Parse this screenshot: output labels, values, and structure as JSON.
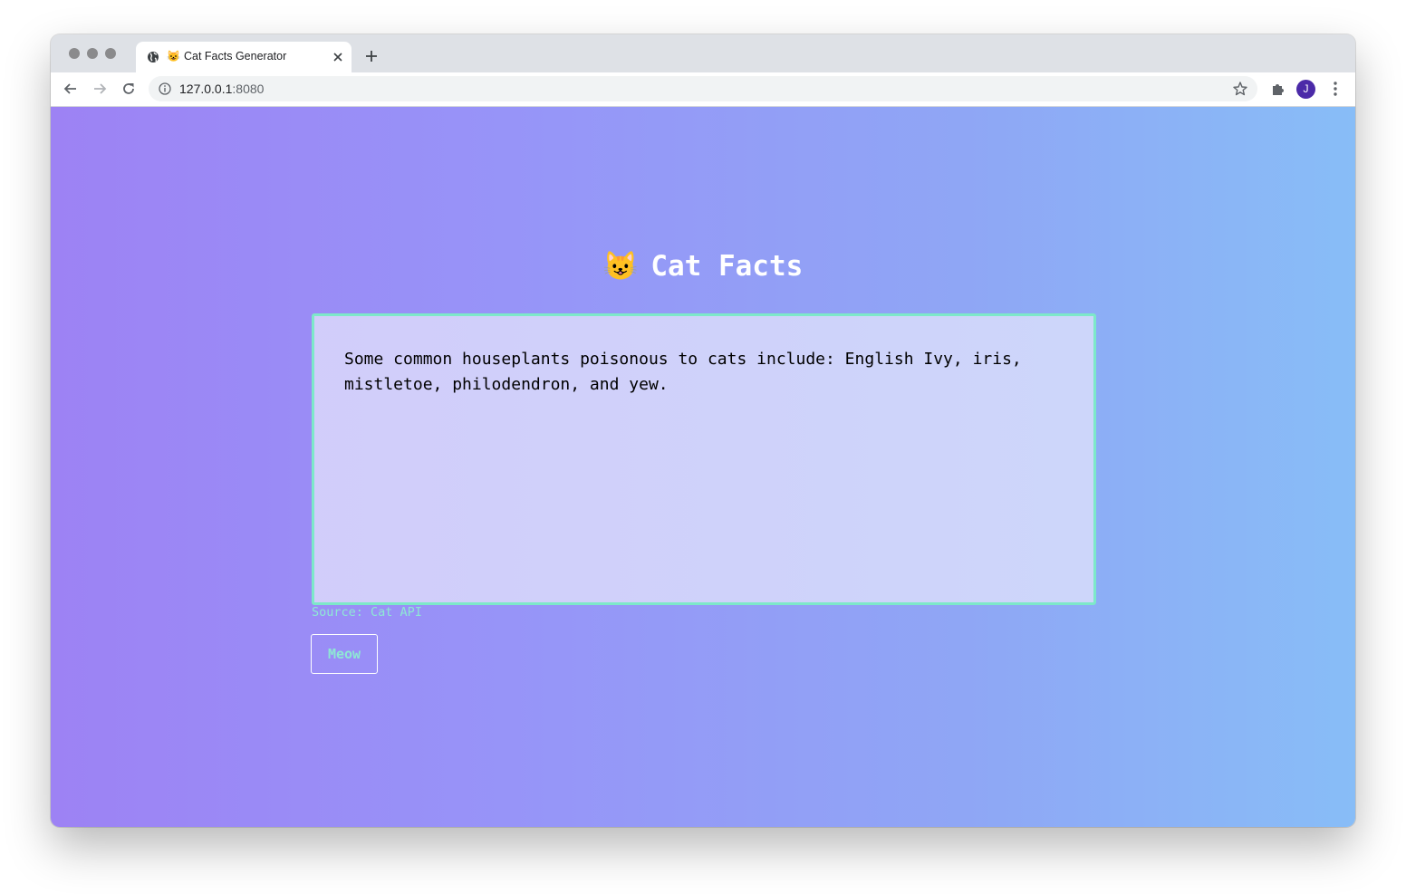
{
  "browser": {
    "tab": {
      "emoji": "😺",
      "title": "Cat Facts Generator"
    },
    "address": {
      "host": "127.0.0.1",
      "port": ":8080"
    },
    "profile_initial": "J"
  },
  "page": {
    "title_emoji": "😺",
    "title": "Cat Facts",
    "fact": "Some common houseplants poisonous to cats include: English Ivy, iris, mistletoe, philodendron, and yew.",
    "source": "Source: Cat API",
    "button_label": "Meow"
  },
  "colors": {
    "accent": "#7de8c9",
    "button_text": "#8ee8d4",
    "gradient_start": "#9d82f4",
    "gradient_end": "#88bdf7",
    "avatar": "#4b2aa8"
  },
  "icons": {
    "tab_favicon": "globe-icon",
    "tab_close": "close-icon",
    "new_tab": "plus-icon",
    "back": "arrow-left-icon",
    "forward": "arrow-right-icon",
    "reload": "reload-icon",
    "site_info": "info-icon",
    "bookmark": "star-icon",
    "extensions": "puzzle-icon",
    "menu": "kebab-menu-icon"
  }
}
